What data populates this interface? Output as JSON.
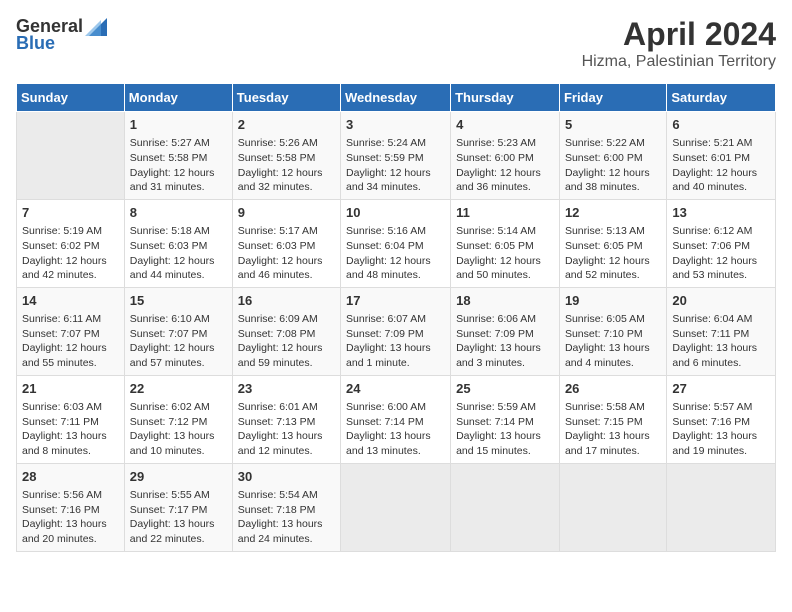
{
  "header": {
    "logo_general": "General",
    "logo_blue": "Blue",
    "month_year": "April 2024",
    "location": "Hizma, Palestinian Territory"
  },
  "days_of_week": [
    "Sunday",
    "Monday",
    "Tuesday",
    "Wednesday",
    "Thursday",
    "Friday",
    "Saturday"
  ],
  "weeks": [
    [
      {
        "day": "",
        "info": ""
      },
      {
        "day": "1",
        "info": "Sunrise: 5:27 AM\nSunset: 5:58 PM\nDaylight: 12 hours\nand 31 minutes."
      },
      {
        "day": "2",
        "info": "Sunrise: 5:26 AM\nSunset: 5:58 PM\nDaylight: 12 hours\nand 32 minutes."
      },
      {
        "day": "3",
        "info": "Sunrise: 5:24 AM\nSunset: 5:59 PM\nDaylight: 12 hours\nand 34 minutes."
      },
      {
        "day": "4",
        "info": "Sunrise: 5:23 AM\nSunset: 6:00 PM\nDaylight: 12 hours\nand 36 minutes."
      },
      {
        "day": "5",
        "info": "Sunrise: 5:22 AM\nSunset: 6:00 PM\nDaylight: 12 hours\nand 38 minutes."
      },
      {
        "day": "6",
        "info": "Sunrise: 5:21 AM\nSunset: 6:01 PM\nDaylight: 12 hours\nand 40 minutes."
      }
    ],
    [
      {
        "day": "7",
        "info": "Sunrise: 5:19 AM\nSunset: 6:02 PM\nDaylight: 12 hours\nand 42 minutes."
      },
      {
        "day": "8",
        "info": "Sunrise: 5:18 AM\nSunset: 6:03 PM\nDaylight: 12 hours\nand 44 minutes."
      },
      {
        "day": "9",
        "info": "Sunrise: 5:17 AM\nSunset: 6:03 PM\nDaylight: 12 hours\nand 46 minutes."
      },
      {
        "day": "10",
        "info": "Sunrise: 5:16 AM\nSunset: 6:04 PM\nDaylight: 12 hours\nand 48 minutes."
      },
      {
        "day": "11",
        "info": "Sunrise: 5:14 AM\nSunset: 6:05 PM\nDaylight: 12 hours\nand 50 minutes."
      },
      {
        "day": "12",
        "info": "Sunrise: 5:13 AM\nSunset: 6:05 PM\nDaylight: 12 hours\nand 52 minutes."
      },
      {
        "day": "13",
        "info": "Sunrise: 6:12 AM\nSunset: 7:06 PM\nDaylight: 12 hours\nand 53 minutes."
      }
    ],
    [
      {
        "day": "14",
        "info": "Sunrise: 6:11 AM\nSunset: 7:07 PM\nDaylight: 12 hours\nand 55 minutes."
      },
      {
        "day": "15",
        "info": "Sunrise: 6:10 AM\nSunset: 7:07 PM\nDaylight: 12 hours\nand 57 minutes."
      },
      {
        "day": "16",
        "info": "Sunrise: 6:09 AM\nSunset: 7:08 PM\nDaylight: 12 hours\nand 59 minutes."
      },
      {
        "day": "17",
        "info": "Sunrise: 6:07 AM\nSunset: 7:09 PM\nDaylight: 13 hours\nand 1 minute."
      },
      {
        "day": "18",
        "info": "Sunrise: 6:06 AM\nSunset: 7:09 PM\nDaylight: 13 hours\nand 3 minutes."
      },
      {
        "day": "19",
        "info": "Sunrise: 6:05 AM\nSunset: 7:10 PM\nDaylight: 13 hours\nand 4 minutes."
      },
      {
        "day": "20",
        "info": "Sunrise: 6:04 AM\nSunset: 7:11 PM\nDaylight: 13 hours\nand 6 minutes."
      }
    ],
    [
      {
        "day": "21",
        "info": "Sunrise: 6:03 AM\nSunset: 7:11 PM\nDaylight: 13 hours\nand 8 minutes."
      },
      {
        "day": "22",
        "info": "Sunrise: 6:02 AM\nSunset: 7:12 PM\nDaylight: 13 hours\nand 10 minutes."
      },
      {
        "day": "23",
        "info": "Sunrise: 6:01 AM\nSunset: 7:13 PM\nDaylight: 13 hours\nand 12 minutes."
      },
      {
        "day": "24",
        "info": "Sunrise: 6:00 AM\nSunset: 7:14 PM\nDaylight: 13 hours\nand 13 minutes."
      },
      {
        "day": "25",
        "info": "Sunrise: 5:59 AM\nSunset: 7:14 PM\nDaylight: 13 hours\nand 15 minutes."
      },
      {
        "day": "26",
        "info": "Sunrise: 5:58 AM\nSunset: 7:15 PM\nDaylight: 13 hours\nand 17 minutes."
      },
      {
        "day": "27",
        "info": "Sunrise: 5:57 AM\nSunset: 7:16 PM\nDaylight: 13 hours\nand 19 minutes."
      }
    ],
    [
      {
        "day": "28",
        "info": "Sunrise: 5:56 AM\nSunset: 7:16 PM\nDaylight: 13 hours\nand 20 minutes."
      },
      {
        "day": "29",
        "info": "Sunrise: 5:55 AM\nSunset: 7:17 PM\nDaylight: 13 hours\nand 22 minutes."
      },
      {
        "day": "30",
        "info": "Sunrise: 5:54 AM\nSunset: 7:18 PM\nDaylight: 13 hours\nand 24 minutes."
      },
      {
        "day": "",
        "info": ""
      },
      {
        "day": "",
        "info": ""
      },
      {
        "day": "",
        "info": ""
      },
      {
        "day": "",
        "info": ""
      }
    ]
  ]
}
